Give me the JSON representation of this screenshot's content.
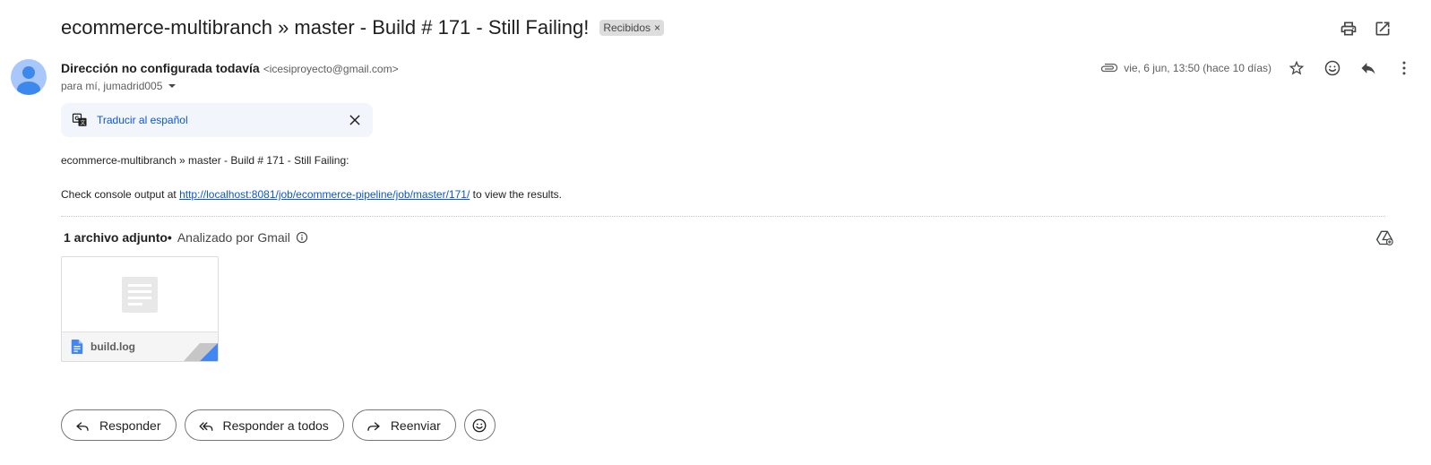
{
  "email": {
    "subject": "ecommerce-multibranch » master - Build # 171 - Still Failing!",
    "label": "Recibidos",
    "label_remove": "×",
    "sender_name": "Dirección no configurada todavía",
    "sender_email": "<icesiproyecto@gmail.com>",
    "recipients": "para mí, jumadrid005",
    "date": "vie, 6 jun, 13:50 (hace 10 días)"
  },
  "translate": {
    "label": "Traducir al español"
  },
  "body": {
    "line1": "ecommerce-multibranch » master - Build # 171 - Still Failing:",
    "line2_prefix": "Check console output at ",
    "line2_link": "http://localhost:8081/job/ecommerce-pipeline/job/master/171/",
    "line2_suffix": " to view the results."
  },
  "attachments": {
    "count_label": "1 archivo adjunto",
    "separator": "•",
    "analyzed_label": "Analizado por Gmail",
    "files": [
      {
        "name": "build.log",
        "icon": "google-docs-icon"
      }
    ]
  },
  "actions": {
    "reply": "Responder",
    "reply_all": "Responder a todos",
    "forward": "Reenviar"
  },
  "icons": {
    "print": "print-icon",
    "open_new_window": "open-in-new-window-icon",
    "attachment": "paperclip-icon",
    "star": "star-icon",
    "emoji": "emoji-icon",
    "reply": "reply-icon",
    "more": "more-vertical-icon",
    "translate": "translate-icon",
    "close": "close-icon",
    "info": "info-icon",
    "add_to_drive": "add-to-drive-icon"
  },
  "colors": {
    "link": "#0b57d0",
    "avatar": "#a8c7fa",
    "translate_bg": "#f2f6fc",
    "docs_blue": "#4285f4"
  }
}
